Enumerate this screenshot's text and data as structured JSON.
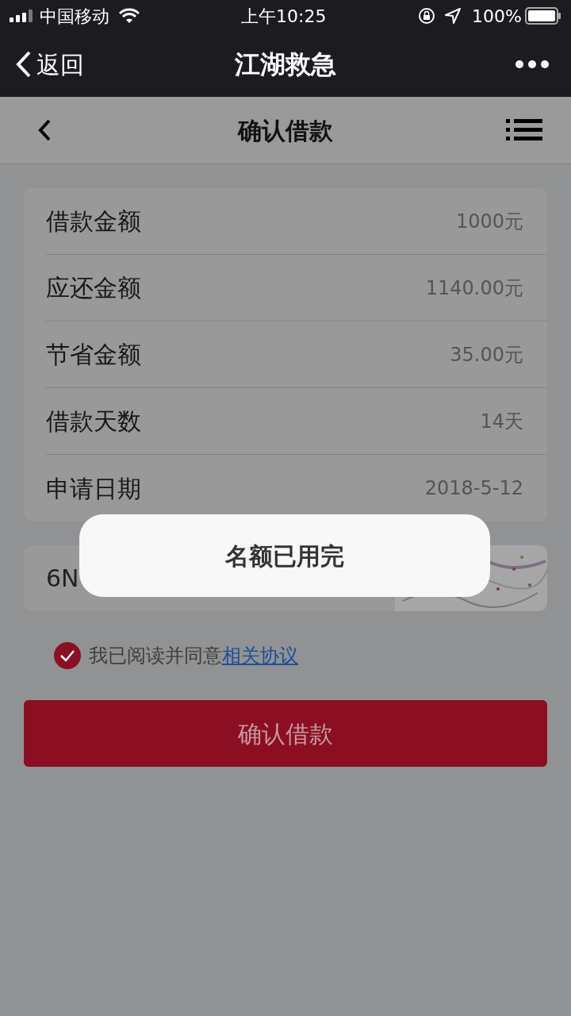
{
  "status_bar": {
    "carrier": "中国移动",
    "time": "上午10:25",
    "battery": "100%"
  },
  "nav_bar": {
    "back": "返回",
    "title": "江湖救急"
  },
  "header": {
    "title": "确认借款"
  },
  "details": [
    {
      "label": "借款金额",
      "value": "1000元"
    },
    {
      "label": "应还金额",
      "value": "1140.00元"
    },
    {
      "label": "节省金额",
      "value": "35.00元"
    },
    {
      "label": "借款天数",
      "value": "14天"
    },
    {
      "label": "申请日期",
      "value": "2018-5-12"
    }
  ],
  "captcha": {
    "value": "6N"
  },
  "agreement": {
    "checked": true,
    "text": "我已阅读并同意",
    "link": "相关协议"
  },
  "confirm_button": "确认借款",
  "toast": "名额已用完"
}
